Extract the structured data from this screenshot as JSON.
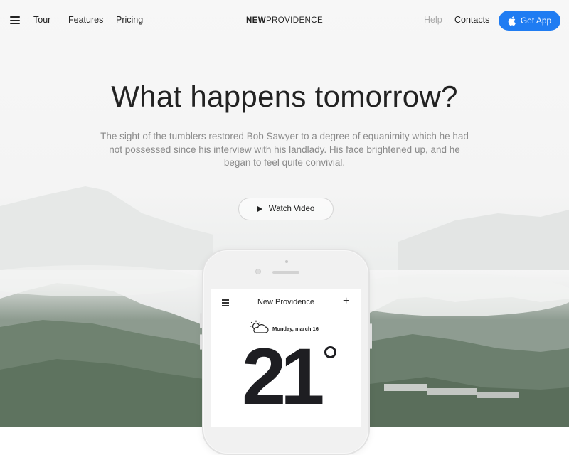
{
  "nav": {
    "links": [
      "Tour",
      "Features",
      "Pricing"
    ],
    "brand_bold": "NEW",
    "brand_light": "PROVIDENCE",
    "help": "Help",
    "contacts": "Contacts",
    "get_app": "Get App"
  },
  "hero": {
    "title": "What happens tomorrow?",
    "text": "The sight of the tumblers restored Bob Sawyer to a degree of equanimity which he had not possessed since his interview with his landlady. His face brightened up, and he began to feel quite convivial.",
    "watch_video": "Watch Video"
  },
  "phone_app": {
    "city": "New Providence",
    "date": "Monday, march 16",
    "temperature": "21",
    "weather_icon": "partly-cloudy-icon"
  },
  "colors": {
    "accent": "#1f7cf2",
    "text": "#222222",
    "muted": "#8a8a8a"
  }
}
